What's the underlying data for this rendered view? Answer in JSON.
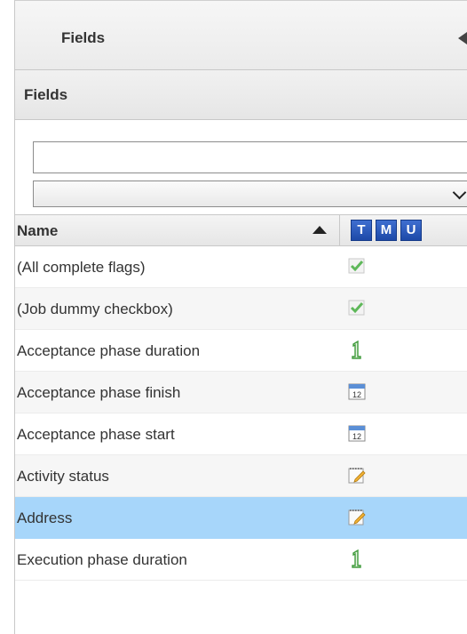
{
  "panel": {
    "tab_title": "Fields",
    "section_title": "Fields"
  },
  "filter": {
    "search_value": "",
    "select_value": ""
  },
  "columns": {
    "name_label": "Name",
    "type_badges": [
      "T",
      "M",
      "U"
    ]
  },
  "rows": [
    {
      "name": "(All complete flags)",
      "icon": "checkbox-check-icon"
    },
    {
      "name": "(Job dummy checkbox)",
      "icon": "checkbox-check-icon"
    },
    {
      "name": "Acceptance phase duration",
      "icon": "number-one-icon"
    },
    {
      "name": "Acceptance phase finish",
      "icon": "calendar-12-icon",
      "icon_text": "12"
    },
    {
      "name": "Acceptance phase start",
      "icon": "calendar-12-icon",
      "icon_text": "12"
    },
    {
      "name": "Activity status",
      "icon": "notepad-pencil-icon"
    },
    {
      "name": "Address",
      "icon": "notepad-pencil-icon",
      "selected": true
    },
    {
      "name": "Execution phase duration",
      "icon": "number-one-icon"
    }
  ],
  "colors": {
    "selected_row": "#a7d6fa",
    "badge_blue": "#1d49a8",
    "check_green": "#5fb85a"
  }
}
